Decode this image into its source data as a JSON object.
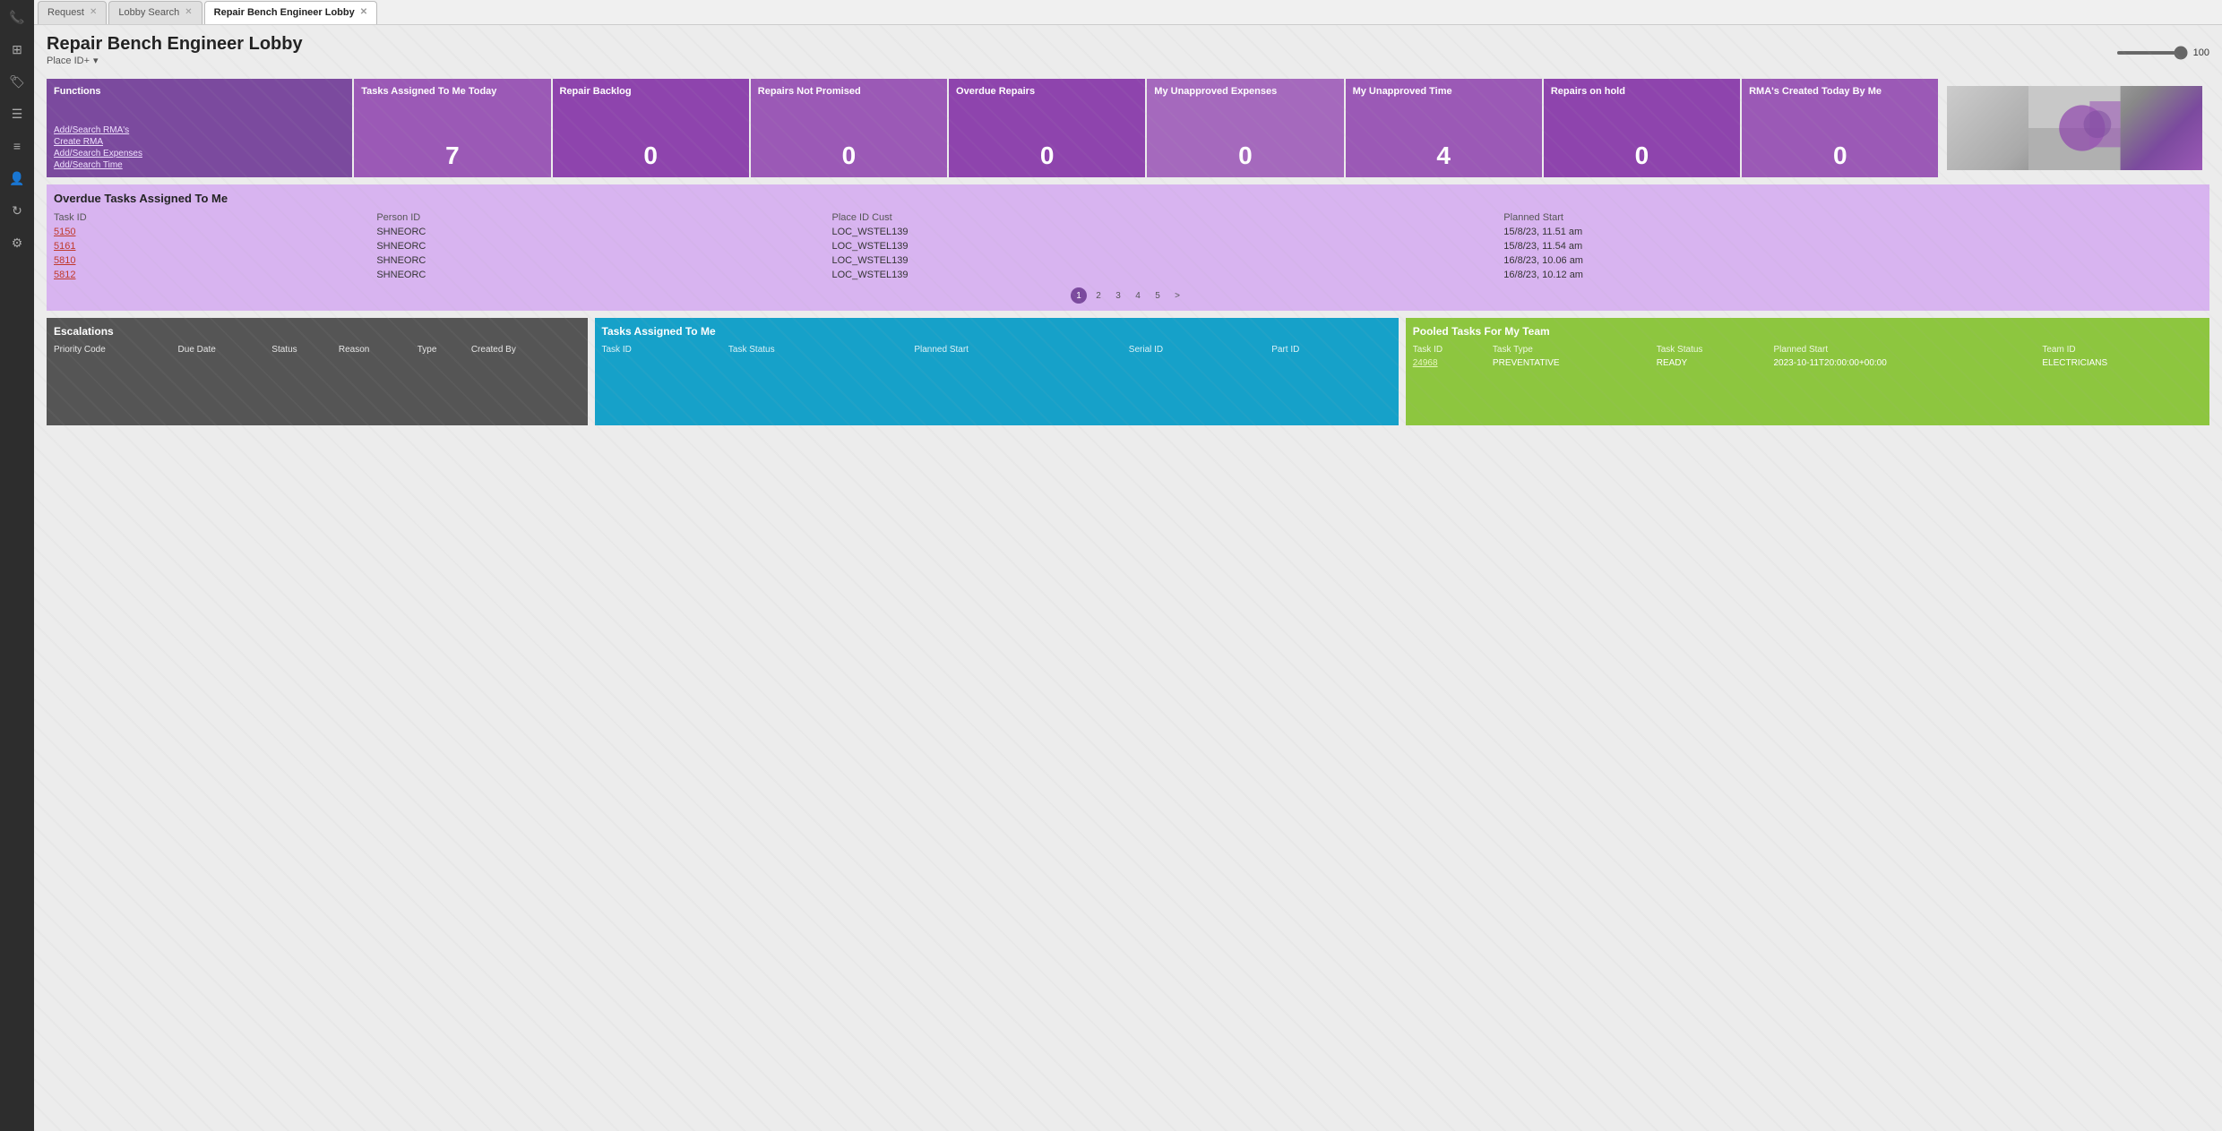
{
  "tabs": [
    {
      "label": "Request",
      "active": false,
      "closable": true
    },
    {
      "label": "Lobby Search",
      "active": false,
      "closable": true
    },
    {
      "label": "Repair Bench Engineer Lobby",
      "active": true,
      "closable": true
    }
  ],
  "page": {
    "title": "Repair Bench Engineer Lobby",
    "place_id_label": "Place ID+",
    "zoom_value": "100"
  },
  "cards": [
    {
      "id": "functions",
      "title": "Functions",
      "type": "functions",
      "links": [
        "Add/Search RMA's",
        "Create RMA",
        "Add/Search Expenses",
        "Add/Search Time"
      ]
    },
    {
      "id": "tasks-assigned",
      "title": "Tasks Assigned To Me Today",
      "value": "7",
      "type": "number"
    },
    {
      "id": "repair-backlog",
      "title": "Repair Backlog",
      "value": "0",
      "type": "number"
    },
    {
      "id": "repairs-not-promised",
      "title": "Repairs Not Promised",
      "value": "0",
      "type": "number"
    },
    {
      "id": "overdue-repairs",
      "title": "Overdue Repairs",
      "value": "0",
      "type": "number"
    },
    {
      "id": "unapproved-expenses",
      "title": "My Unapproved Expenses",
      "value": "0",
      "type": "number"
    },
    {
      "id": "unapproved-time",
      "title": "My Unapproved Time",
      "value": "4",
      "type": "number"
    },
    {
      "id": "repairs-on-hold",
      "title": "Repairs on hold",
      "value": "0",
      "type": "number"
    },
    {
      "id": "rmas-created",
      "title": "RMA's Created Today By Me",
      "value": "0",
      "type": "number"
    },
    {
      "id": "image-card",
      "type": "image"
    }
  ],
  "overdue_tasks": {
    "title": "Overdue Tasks Assigned To Me",
    "columns": [
      "Task ID",
      "Person ID",
      "Place ID Cust",
      "Planned Start"
    ],
    "rows": [
      {
        "task_id": "5150",
        "person_id": "SHNEORC",
        "place_id": "LOC_WSTEL139",
        "planned_start": "15/8/23, 11.51 am"
      },
      {
        "task_id": "5161",
        "person_id": "SHNEORC",
        "place_id": "LOC_WSTEL139",
        "planned_start": "15/8/23, 11.54 am"
      },
      {
        "task_id": "5810",
        "person_id": "SHNEORC",
        "place_id": "LOC_WSTEL139",
        "planned_start": "16/8/23, 10.06 am"
      },
      {
        "task_id": "5812",
        "person_id": "SHNEORC",
        "place_id": "LOC_WSTEL139",
        "planned_start": "16/8/23, 10.12 am"
      }
    ],
    "pagination": [
      "1",
      "2",
      "3",
      "4",
      "5",
      ">"
    ]
  },
  "escalations": {
    "title": "Escalations",
    "columns": [
      "Priority Code",
      "Due Date",
      "Status",
      "Reason",
      "Type",
      "Created By"
    ],
    "rows": []
  },
  "tasks_assigned": {
    "title": "Tasks Assigned To Me",
    "columns": [
      "Task ID",
      "Task Status",
      "Planned Start",
      "Serial ID",
      "Part ID"
    ],
    "rows": []
  },
  "pooled_tasks": {
    "title": "Pooled Tasks For My Team",
    "columns": [
      "Task ID",
      "Task Type",
      "Task Status",
      "Planned Start",
      "Team ID"
    ],
    "rows": [
      {
        "task_id": "24968",
        "task_type": "PREVENTATIVE",
        "task_status": "READY",
        "planned_start": "2023-10-11T20:00:00+00:00",
        "team_id": "ELECTRICIANS"
      }
    ]
  },
  "sidebar_icons": [
    {
      "name": "phone-icon",
      "symbol": "📞"
    },
    {
      "name": "grid-icon",
      "symbol": "⊞"
    },
    {
      "name": "tag-icon",
      "symbol": "🏷"
    },
    {
      "name": "list-icon",
      "symbol": "☰"
    },
    {
      "name": "menu-icon",
      "symbol": "≡"
    },
    {
      "name": "person-icon",
      "symbol": "👤"
    },
    {
      "name": "refresh-icon",
      "symbol": "↻"
    },
    {
      "name": "settings-icon",
      "symbol": "⚙"
    }
  ]
}
